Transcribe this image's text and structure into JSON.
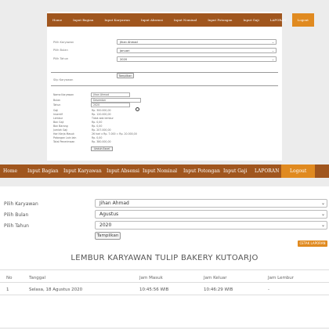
{
  "nav": {
    "items": [
      "Home",
      "Input Bagian",
      "Input Karyawan",
      "Input Absensi",
      "Input Nominal",
      "Input Potongan",
      "Input Gaji",
      "LAPORAN"
    ],
    "logout": "Logout"
  },
  "form": {
    "karyawan_label": "Pilih Karyawan",
    "karyawan_value": "Jihan Ahmad",
    "bulan_label": "Pilih Bulan",
    "bulan_value": "Agustus",
    "tahun_label": "Pilih Tahun",
    "tahun_value": "2020",
    "submit_label": "Tampilkan"
  },
  "print_button": "CETAK LAPORAN",
  "report_title": "LEMBUR KARYAWAN TULIP BAKERY KUTOARJO",
  "table": {
    "headers": [
      "No",
      "Tanggal",
      "Jam Masuk",
      "Jam Keluar",
      "Jam Lembur"
    ],
    "rows": [
      [
        "1",
        "Selasa, 18 Agustus 2020",
        "10:45:56 WIB",
        "10:46:29 WIB",
        "-"
      ]
    ]
  },
  "mini": {
    "karyawan_label": "Pilih Karyawan",
    "karyawan_value": "Jihan Ahmad",
    "bulan_label": "Pilih Bulan",
    "bulan_value": "Januari",
    "tahun_label": "Pilih Tahun",
    "tahun_value": "2020",
    "submit_label": "Tampilkan",
    "slip_heading": "Slip Karyawan",
    "slip": [
      [
        "Nama Karyawan",
        "Jihan Ahmad"
      ],
      [
        "Bulan",
        "Desember"
      ],
      [
        "Tahun",
        "2020"
      ],
      [
        "Gaji",
        "Rp. 300.000,00"
      ],
      [
        "Insentif",
        "Rp. 120.000,00"
      ],
      [
        "Lembur",
        "Tidak ada lembur"
      ],
      [
        "Bon Gaji",
        "Rp. 0,00"
      ],
      [
        "Bon Barang",
        "Rp. 0,00"
      ],
      [
        "Jumlah Gaji",
        "Rp. 207.000,00"
      ],
      [
        "Hari Kerja Masuk",
        "26 hari x Rp. 7.000 = Rp. 20.000,00"
      ],
      [
        "Potongan Lain lain",
        "Rp. 0,00"
      ],
      [
        "Total Penerimaan",
        "Rp. 380.000,00"
      ]
    ],
    "slip_button": "Unduh Excel"
  }
}
